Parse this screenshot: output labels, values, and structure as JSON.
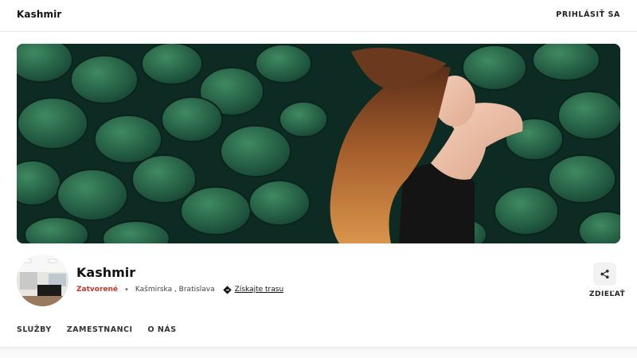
{
  "header": {
    "brand": "Kashmir",
    "login_label": "PRIHLÁSIŤ SA"
  },
  "salon": {
    "name": "Kashmir",
    "status": "Zatvorené",
    "address": "Kašmirska , Bratislava",
    "route_label": "Získajte trasu",
    "share_label": "ZDIEĽAŤ"
  },
  "tabs": [
    {
      "label": "SLUŽBY"
    },
    {
      "label": "ZAMESTNANCI"
    },
    {
      "label": "O NÁS"
    }
  ],
  "colors": {
    "status_closed": "#c0392b",
    "hero_leaf": "#1f5a3f",
    "accent_text": "#111111"
  },
  "icons": {
    "share": "share-icon",
    "route": "directions-icon"
  }
}
